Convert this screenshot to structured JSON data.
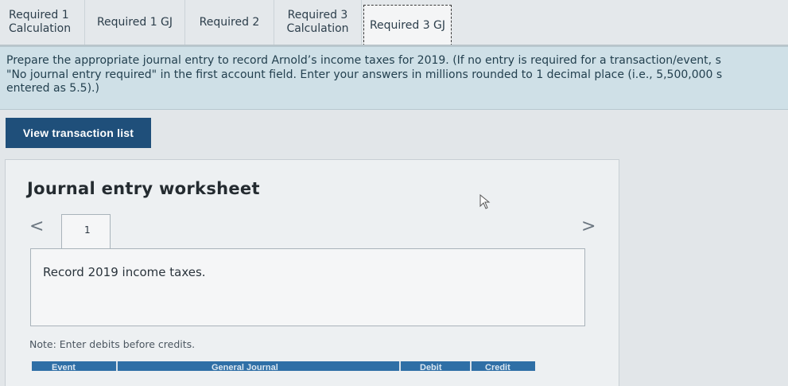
{
  "tabs": [
    {
      "line1": "Required 1",
      "line2": "Calculation"
    },
    {
      "label": "Required 1 GJ"
    },
    {
      "label": "Required 2"
    },
    {
      "line1": "Required 3",
      "line2": "Calculation"
    },
    {
      "label": "Required 3 GJ"
    }
  ],
  "instructions": {
    "line1": "Prepare the appropriate journal entry to record Arnold’s income taxes for 2019. (If no entry is required for a transaction/event, s",
    "line2": "\"No journal entry required\" in the first account field. Enter your answers in millions rounded to 1 decimal place (i.e., 5,500,000 s",
    "line3": "entered as 5.5).)"
  },
  "view_button_label": "View transaction list",
  "worksheet": {
    "title": "Journal entry worksheet",
    "nav_prev": "<",
    "nav_next": ">",
    "entry_tab_label": "1",
    "entry_description": "Record 2019 income taxes.",
    "note": "Note: Enter debits before credits.",
    "table_headers": [
      "Event",
      "General Journal",
      "Debit",
      "Credit"
    ]
  },
  "colors": {
    "accent_button": "#1f4f7a",
    "instruction_band": "#cfe0e7",
    "table_header": "#2f6fa6"
  }
}
